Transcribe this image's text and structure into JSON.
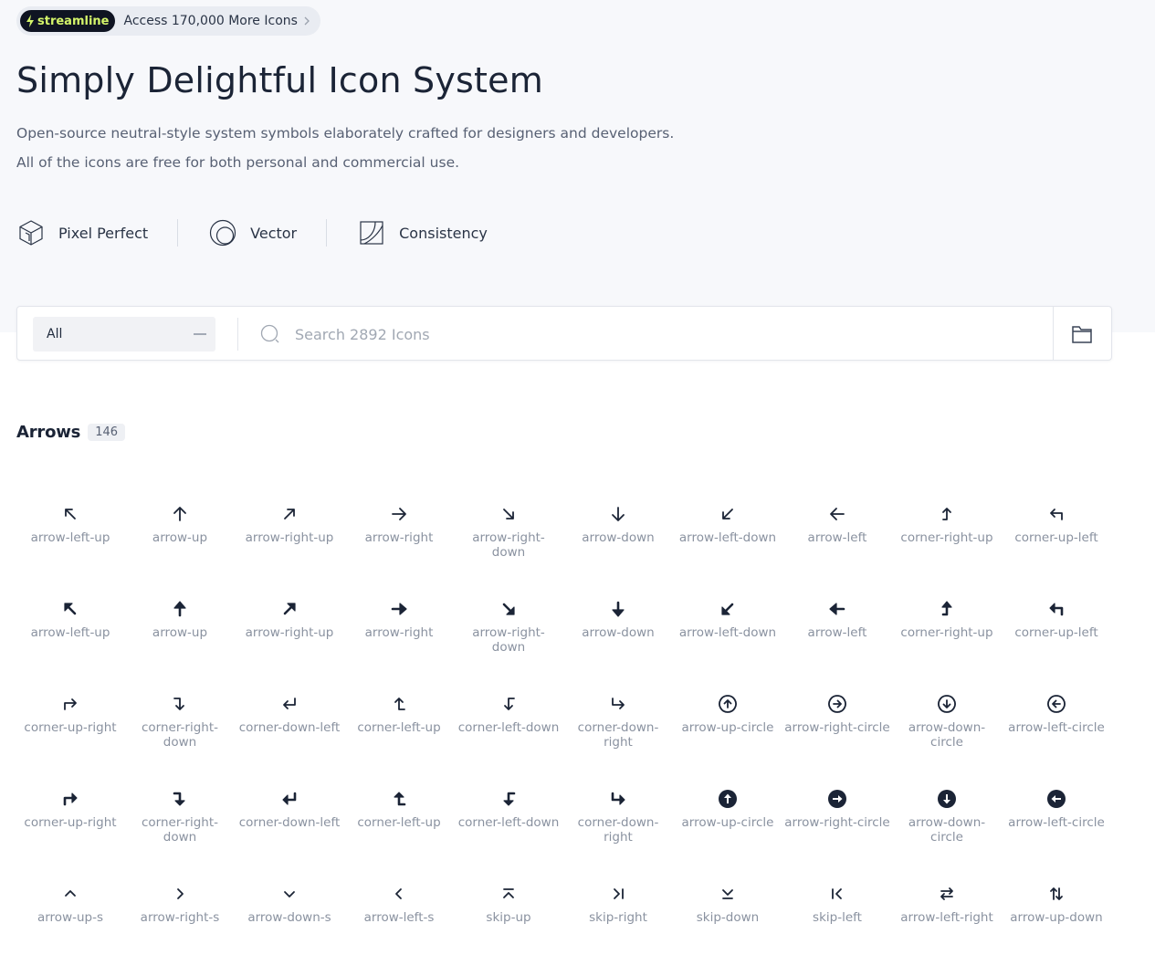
{
  "promo": {
    "badge": "streamline",
    "text": "Access 170,000 More Icons",
    "icons": {
      "badge": "bolt-icon",
      "arrow": "chevron-right-icon"
    }
  },
  "hero": {
    "title": "Simply Delightful Icon System",
    "subtitle_1": "Open-source neutral-style system symbols elaborately crafted for designers and developers.",
    "subtitle_2": "All of the icons are free for both personal and commercial use."
  },
  "features": [
    {
      "label": "Pixel Perfect",
      "icon": "cube-icon"
    },
    {
      "label": "Vector",
      "icon": "circles-icon"
    },
    {
      "label": "Consistency",
      "icon": "square-curve-icon"
    }
  ],
  "search": {
    "category_value": "All",
    "placeholder": "Search 2892 Icons",
    "value": "",
    "icons": {
      "search": "search-icon",
      "folder": "folder-icon"
    }
  },
  "section": {
    "title": "Arrows",
    "count": "146"
  },
  "icons": [
    {
      "label": "arrow-left-up",
      "icon": "arrow-left-up"
    },
    {
      "label": "arrow-up",
      "icon": "arrow-up"
    },
    {
      "label": "arrow-right-up",
      "icon": "arrow-right-up"
    },
    {
      "label": "arrow-right",
      "icon": "arrow-right"
    },
    {
      "label": "arrow-right-down",
      "icon": "arrow-right-down"
    },
    {
      "label": "arrow-down",
      "icon": "arrow-down"
    },
    {
      "label": "arrow-left-down",
      "icon": "arrow-left-down"
    },
    {
      "label": "arrow-left",
      "icon": "arrow-left"
    },
    {
      "label": "corner-right-up",
      "icon": "corner-right-up"
    },
    {
      "label": "corner-up-left",
      "icon": "corner-up-left"
    },
    {
      "label": "arrow-left-up",
      "icon": "arrow-left-up-bold"
    },
    {
      "label": "arrow-up",
      "icon": "arrow-up-bold"
    },
    {
      "label": "arrow-right-up",
      "icon": "arrow-right-up-bold"
    },
    {
      "label": "arrow-right",
      "icon": "arrow-right-bold"
    },
    {
      "label": "arrow-right-down",
      "icon": "arrow-right-down-bold"
    },
    {
      "label": "arrow-down",
      "icon": "arrow-down-bold"
    },
    {
      "label": "arrow-left-down",
      "icon": "arrow-left-down-bold"
    },
    {
      "label": "arrow-left",
      "icon": "arrow-left-bold"
    },
    {
      "label": "corner-right-up",
      "icon": "corner-right-up-bold"
    },
    {
      "label": "corner-up-left",
      "icon": "corner-up-left-bold"
    },
    {
      "label": "corner-up-right",
      "icon": "corner-up-right"
    },
    {
      "label": "corner-right-down",
      "icon": "corner-right-down"
    },
    {
      "label": "corner-down-left",
      "icon": "corner-down-left"
    },
    {
      "label": "corner-left-up",
      "icon": "corner-left-up"
    },
    {
      "label": "corner-left-down",
      "icon": "corner-left-down"
    },
    {
      "label": "corner-down-right",
      "icon": "corner-down-right"
    },
    {
      "label": "arrow-up-circle",
      "icon": "arrow-up-circle"
    },
    {
      "label": "arrow-right-circle",
      "icon": "arrow-right-circle"
    },
    {
      "label": "arrow-down-circle",
      "icon": "arrow-down-circle"
    },
    {
      "label": "arrow-left-circle",
      "icon": "arrow-left-circle"
    },
    {
      "label": "corner-up-right",
      "icon": "corner-up-right-bold"
    },
    {
      "label": "corner-right-down",
      "icon": "corner-right-down-bold"
    },
    {
      "label": "corner-down-left",
      "icon": "corner-down-left-bold"
    },
    {
      "label": "corner-left-up",
      "icon": "corner-left-up-bold"
    },
    {
      "label": "corner-left-down",
      "icon": "corner-left-down-bold"
    },
    {
      "label": "corner-down-right",
      "icon": "corner-down-right-bold"
    },
    {
      "label": "arrow-up-circle",
      "icon": "arrow-up-circle-fill"
    },
    {
      "label": "arrow-right-circle",
      "icon": "arrow-right-circle-fill"
    },
    {
      "label": "arrow-down-circle",
      "icon": "arrow-down-circle-fill"
    },
    {
      "label": "arrow-left-circle",
      "icon": "arrow-left-circle-fill"
    },
    {
      "label": "arrow-up-s",
      "icon": "arrow-up-s"
    },
    {
      "label": "arrow-right-s",
      "icon": "arrow-right-s"
    },
    {
      "label": "arrow-down-s",
      "icon": "arrow-down-s"
    },
    {
      "label": "arrow-left-s",
      "icon": "arrow-left-s"
    },
    {
      "label": "skip-up",
      "icon": "skip-up"
    },
    {
      "label": "skip-right",
      "icon": "skip-right"
    },
    {
      "label": "skip-down",
      "icon": "skip-down"
    },
    {
      "label": "skip-left",
      "icon": "skip-left"
    },
    {
      "label": "arrow-left-right",
      "icon": "arrow-left-right"
    },
    {
      "label": "arrow-up-down",
      "icon": "arrow-up-down"
    }
  ],
  "colors": {
    "ink": "#1b2436",
    "muted": "#8a92a0",
    "hero_bg": "#f7f8fb",
    "badge_bg": "#0f1422",
    "badge_fg": "#d4f56a"
  }
}
